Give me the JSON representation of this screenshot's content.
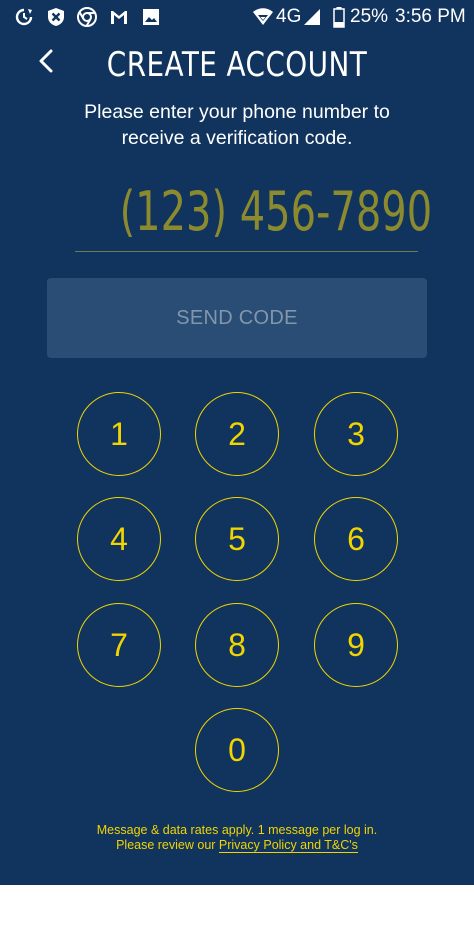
{
  "status_bar": {
    "icons_left": [
      "sync-icon",
      "blocked-app-icon",
      "chrome-icon",
      "gmail-icon",
      "gallery-icon"
    ],
    "icons_right": [
      "wifi-icon",
      "cellular-signal-icon",
      "battery-icon"
    ],
    "network": "4G",
    "battery": "25%",
    "time": "3:56 PM"
  },
  "header": {
    "title": "CREATE ACCOUNT",
    "back_icon": "chevron-left-icon"
  },
  "subtitle": {
    "line1": "Please enter your phone number to",
    "line2": "receive a verification code."
  },
  "phone_input": {
    "value": "(123) 456-7890"
  },
  "send_button": {
    "label": "SEND CODE"
  },
  "keypad": {
    "keys": [
      "1",
      "2",
      "3",
      "4",
      "5",
      "6",
      "7",
      "8",
      "9",
      "0"
    ]
  },
  "footer": {
    "line1": "Message & data rates apply. 1 message per log in.",
    "line2_prefix": "Please review our ",
    "link_text": "Privacy Policy and T&C's"
  },
  "colors": {
    "background": "#10345e",
    "accent": "#f1d400",
    "button": "#294d74",
    "button_text": "#8296ad",
    "phone_text": "#8c8a2f"
  }
}
